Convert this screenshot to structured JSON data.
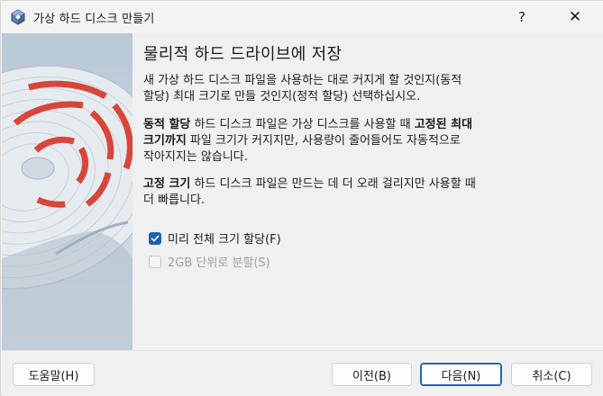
{
  "window": {
    "title": "가상 하드 디스크 만들기",
    "help_glyph": "?",
    "close_glyph": "✕"
  },
  "page": {
    "title": "물리적 하드 드라이브에 저장",
    "intro_line1": "새 가상 하드 디스크 파일을 사용하는 대로 커지게 할 것인지(동적",
    "intro_line2": "할당) 최대 크기로 만들 것인지(정적 할당) 선택하십시오.",
    "dynamic": {
      "bold1": "동적 할당",
      "text1": " 하드 디스크 파일은 가상 디스크를 사용할 때 ",
      "bold2": "고정된 최대",
      "bold3": "크기까지",
      "text2": " 파일 크기가 커지지만, 사용량이 줄어들어도 자동적으로",
      "text3": "작아지지는 않습니다."
    },
    "fixed": {
      "bold1": "고정 크기",
      "text1": " 하드 디스크 파일은 만드는 데 더 오래 걸리지만 사용할 때",
      "text2": "더 빠릅니다."
    }
  },
  "options": {
    "preallocate": {
      "label": "미리 전체 크기 할당(F)",
      "checked": true
    },
    "split": {
      "label": "2GB 단위로 분할(S)",
      "checked": false,
      "enabled": false
    }
  },
  "buttons": {
    "help": "도움말(H)",
    "back": "이전(B)",
    "next": "다음(N)",
    "cancel": "취소(C)"
  },
  "colors": {
    "accent": "#1c5fb5",
    "art_red": "#d8453a",
    "art_blue_gray": "#c7d3de"
  },
  "icons": [
    "virtualbox-icon",
    "help-icon",
    "close-icon",
    "hard-disk-watermark",
    "checkmark-icon"
  ]
}
